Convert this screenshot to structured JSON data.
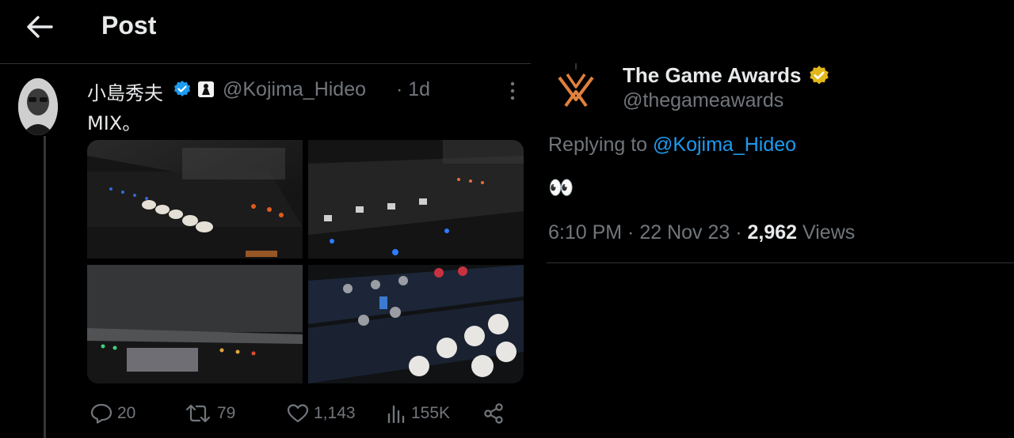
{
  "header": {
    "title": "Post",
    "back_icon": "arrow-left-icon"
  },
  "tweet": {
    "author_name": "小島秀夫",
    "handle": "@Kojima_Hideo",
    "time_ago": "· 1d",
    "text": "MIX。",
    "stats": {
      "replies": "20",
      "reposts": "79",
      "likes": "1,143",
      "views": "155K"
    }
  },
  "reply": {
    "author_name": "The Game Awards",
    "handle": "@thegameawards",
    "replying_to_prefix": "Replying to",
    "replying_to_handle": "@Kojima_Hideo",
    "text": "👀",
    "timestamp": "6:10 PM · 22 Nov 23 ·",
    "views_count": "2,962",
    "views_label": "Views"
  },
  "colors": {
    "accent": "#1d9bf0",
    "muted": "#71767b",
    "gold": "#e2b719",
    "tga_orange": "#e0813d"
  }
}
